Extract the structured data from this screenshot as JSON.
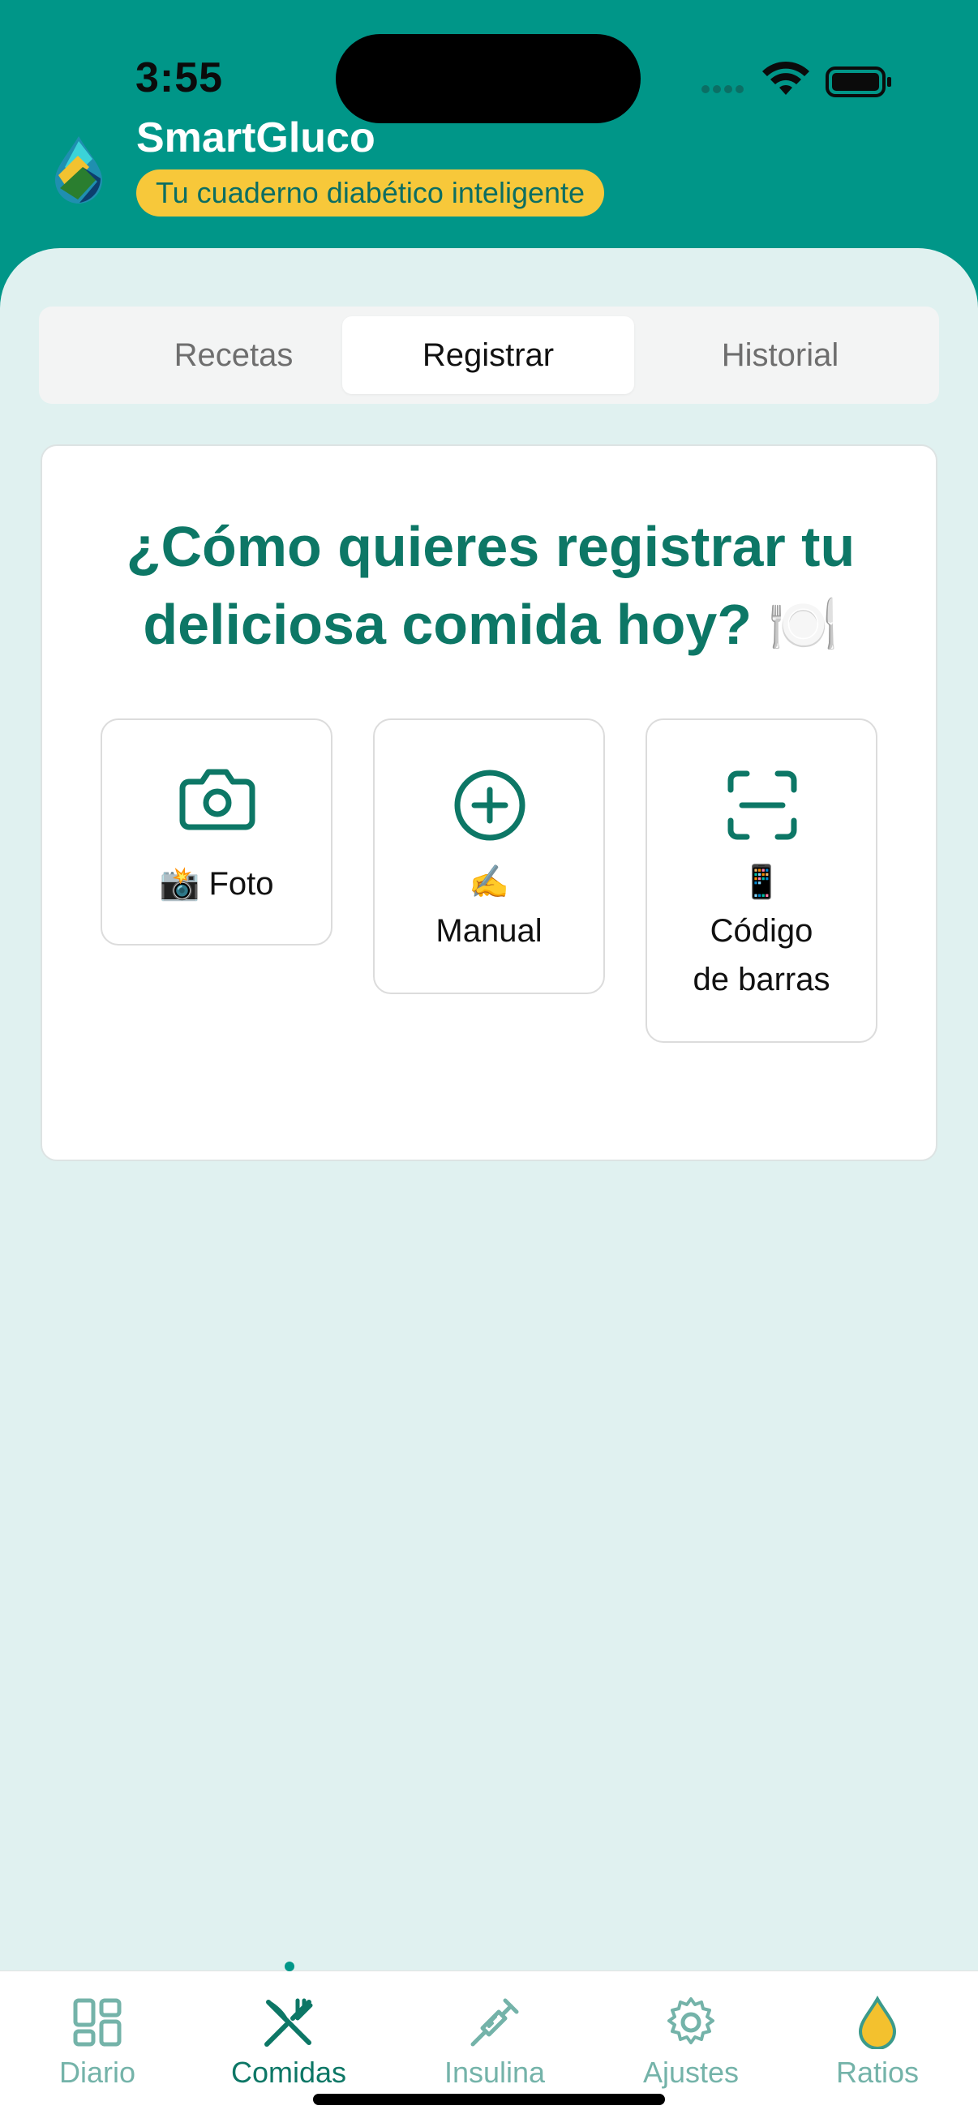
{
  "status_bar": {
    "time": "3:55"
  },
  "app": {
    "title": "SmartGluco",
    "tagline": "Tu cuaderno diabético inteligente"
  },
  "tabs": [
    {
      "label": "Recetas",
      "active": false
    },
    {
      "label": "Registrar",
      "active": true
    },
    {
      "label": "Historial",
      "active": false
    }
  ],
  "register": {
    "question_line1": "¿Cómo quieres registrar tu",
    "question_line2": "deliciosa comida hoy? 🍽️",
    "options": [
      {
        "icon": "camera-icon",
        "emoji": "📸",
        "label": "Foto"
      },
      {
        "icon": "plus-circle-icon",
        "emoji": "✍️",
        "label": "Manual"
      },
      {
        "icon": "barcode-scan-icon",
        "emoji": "📱",
        "label_line1": "Código",
        "label_line2": "de barras"
      }
    ]
  },
  "bottom_nav": [
    {
      "label": "Diario",
      "icon": "grid-icon",
      "active": false
    },
    {
      "label": "Comidas",
      "icon": "utensils-icon",
      "active": true
    },
    {
      "label": "Insulina",
      "icon": "syringe-icon",
      "active": false
    },
    {
      "label": "Ajustes",
      "icon": "gear-icon",
      "active": false
    },
    {
      "label": "Ratios",
      "icon": "drop-icon",
      "active": false
    }
  ],
  "colors": {
    "brand": "#009688",
    "accent_text": "#0d7766",
    "tagline_bg": "#f7c83a",
    "background": "#e0f1f0",
    "nav_inactive": "#74b3a9"
  }
}
